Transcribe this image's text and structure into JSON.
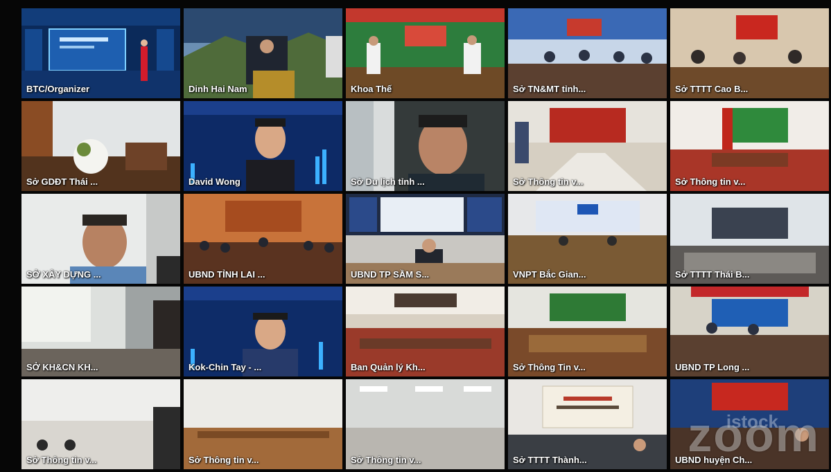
{
  "meeting": {
    "tiles": [
      {
        "name": "BTC/Organizer",
        "scene": "stage",
        "active": true
      },
      {
        "name": "Dinh Hai Nam",
        "scene": "landscape"
      },
      {
        "name": "Khoa Thế",
        "scene": "green-room"
      },
      {
        "name": "Sở TN&MT tỉnh...",
        "scene": "conference"
      },
      {
        "name": "Sở TTTT Cao B...",
        "scene": "office-warm"
      },
      {
        "name": "Sở GDĐT Thái ...",
        "scene": "flowers"
      },
      {
        "name": "David Wong",
        "scene": "presenter"
      },
      {
        "name": "Sở Du lịch tỉnh ...",
        "scene": "closeup"
      },
      {
        "name": "Sở Thông tin v...",
        "scene": "hall-red"
      },
      {
        "name": "Sở Thông tin v...",
        "scene": "hall-green"
      },
      {
        "name": "SỞ XÂY DỰNG ...",
        "scene": "person-light"
      },
      {
        "name": "UBND TỈNH LAI ...",
        "scene": "hall-orange"
      },
      {
        "name": "UBND TP SẦM S...",
        "scene": "screens"
      },
      {
        "name": "VNPT Bắc Gian...",
        "scene": "hall-blue"
      },
      {
        "name": "Sở TTTT Thái B...",
        "scene": "hall-grey"
      },
      {
        "name": "SỞ KH&CN KH...",
        "scene": "office-light"
      },
      {
        "name": "Kok-Chin Tay - ...",
        "scene": "presenter2"
      },
      {
        "name": "Ban Quản lý Kh...",
        "scene": "ceiling-hall"
      },
      {
        "name": "Sở Thông Tin v...",
        "scene": "hall-green2"
      },
      {
        "name": "UBND TP Long ...",
        "scene": "hall-red2"
      },
      {
        "name": "Sở Thông tin v...",
        "scene": "white-room"
      },
      {
        "name": "Sở Thông tin v...",
        "scene": "empty-room"
      },
      {
        "name": "Sở Thông tin v...",
        "scene": "ceiling-lights"
      },
      {
        "name": "Sở TTTT Thành...",
        "scene": "sign-room"
      },
      {
        "name": "UBND huyện Ch...",
        "scene": "hall-red3"
      }
    ]
  },
  "watermark": {
    "brand": "zoom",
    "prefix": "istock"
  },
  "colors": {
    "active_border": "#35d43a",
    "background": "#060606"
  }
}
